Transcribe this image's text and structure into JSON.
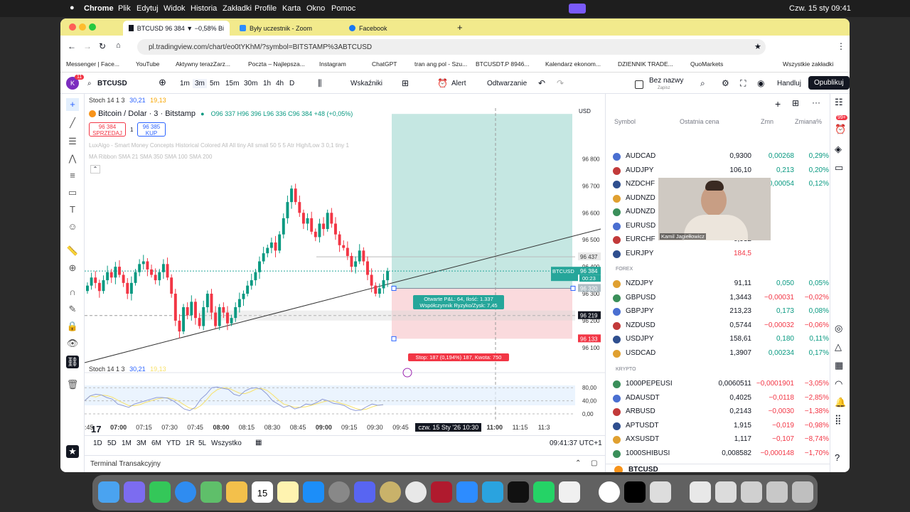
{
  "menubar": {
    "apple": "",
    "app": "Chrome",
    "items": [
      "Plik",
      "Edytuj",
      "Widok",
      "Historia",
      "Zakładki",
      "Profile",
      "Karta",
      "Okno",
      "Pomoc"
    ],
    "clock": "Czw. 15 sty  09:41"
  },
  "tabs": [
    {
      "label": "BTCUSD 96 384 ▼ −0,58% Bi",
      "active": true
    },
    {
      "label": "Były uczestnik - Zoom",
      "active": false
    },
    {
      "label": "Facebook",
      "active": false
    }
  ],
  "address": {
    "url": "pl.tradingview.com/chart/eo0tYKhM/?symbol=BITSTAMP%3ABTCUSD"
  },
  "bookmarks": [
    "Messenger | Face...",
    "YouTube",
    "Aktywny terazZarz...",
    "Poczta – Najlepsza...",
    "Instagram",
    "ChatGPT",
    "tran ang pol - Szu...",
    "BTCUSDT.P 8946...",
    "Kalendarz ekonom...",
    "DZIENNIK TRADE...",
    "QuoMarkets",
    "Wszystkie zakładki"
  ],
  "toolbar": {
    "symbol": "BTCUSD",
    "intervals": [
      "1m",
      "3m",
      "5m",
      "15m",
      "30m",
      "1h",
      "4h",
      "D"
    ],
    "active_interval": "3m",
    "indicators": "Wskaźniki",
    "alert": "Alert",
    "replay": "Odtwarzanie",
    "layout_name": "Bez nazwy",
    "layout_sub": "Zapisz",
    "trade": "Handluj",
    "publish": "Opublikuj",
    "avatar_badge": "11"
  },
  "chart": {
    "title": "Bitcoin / Dolar · 3 · Bitstamp",
    "ohlc": "O96 337  H96 396  L96 336  C96 384  +48 (+0,05%)",
    "sell_price": "96 384",
    "sell_label": "SPRZEDAJ",
    "spread": "1",
    "buy_price": "96 385",
    "buy_label": "KUP",
    "indicator1": "LuxAlgo - Smart Money Concepts Historical Colored All All tiny All small 50 5 5 Atr High/Low 3 0,1 tiny 1",
    "indicator2": "MA Ribbon SMA 21 SMA 350 SMA 100 SMA 200",
    "stoch_top": "Stoch 14 1 3",
    "stoch_top_k": "30,21",
    "stoch_top_d": "19,13",
    "currency": "USD",
    "pnl_line1": "Otwarte P&L: 64, Ilość: 1.337",
    "pnl_line2": "Współczynnik Ryzyko/Zysk: 7,45",
    "stop_label": "Stop: 187 (0,194%) 187, Kwota: 750",
    "price_labels": {
      "top": "96 437",
      "current_sym": "BTCUSD",
      "current": "96 384",
      "countdown": "00:23",
      "entry": "96 320",
      "cross": "96 219",
      "stop": "96 133"
    },
    "y_ticks": [
      "96 800",
      "96 700",
      "96 600",
      "96 500",
      "96 400",
      "96 300",
      "96 200",
      "96 100"
    ],
    "stoch_label": "Stoch 14 1 3",
    "stoch_k": "30,21",
    "stoch_d": "19,13",
    "stoch_ticks": [
      "80,00",
      "40,00",
      "0,00"
    ]
  },
  "chart_data": {
    "type": "candlestick",
    "title": "Bitcoin / Dolar · 3 · Bitstamp",
    "x_ticks": [
      ":45",
      "07:00",
      "07:15",
      "07:30",
      "07:45",
      "08:00",
      "08:15",
      "08:30",
      "08:45",
      "09:00",
      "09:15",
      "09:30",
      "09:45",
      "10:00",
      "czw. 15 Sty '26   10:30",
      "11:00",
      "11:15",
      "11:3"
    ],
    "ylim": [
      96060,
      96920
    ],
    "y_ticks": [
      96800,
      96700,
      96600,
      96500,
      96400,
      96300,
      96200,
      96100
    ],
    "close": [
      96330,
      96360,
      96340,
      96310,
      96350,
      96380,
      96360,
      96400,
      96370,
      96340,
      96300,
      96340,
      96380,
      96410,
      96420,
      96390,
      96370,
      96350,
      96380,
      96410,
      96360,
      96300,
      96200,
      96160,
      96250,
      96220,
      96270,
      96210,
      96180,
      96250,
      96300,
      96230,
      96180,
      96250,
      96230,
      96190,
      96210,
      96250,
      96280,
      96300,
      96330,
      96350,
      96380,
      96420,
      96450,
      96470,
      96490,
      96460,
      96520,
      96580,
      96640,
      96690,
      96640,
      96600,
      96560,
      96580,
      96530,
      96510,
      96560,
      96540,
      96600,
      96560,
      96520,
      96480,
      96470,
      96440,
      96400,
      96420,
      96460,
      96420,
      96370,
      96330,
      96300,
      96320,
      96350,
      96384
    ],
    "stoch_k": [
      40,
      55,
      60,
      58,
      50,
      45,
      30,
      25,
      20,
      30,
      35,
      40,
      45,
      50,
      50,
      48,
      40,
      28,
      15,
      10,
      20,
      45,
      60,
      80,
      82,
      78,
      75,
      60,
      55,
      70,
      78,
      80,
      75,
      60,
      40,
      30,
      20,
      25,
      15,
      20,
      30,
      28,
      35,
      45,
      40,
      32,
      30,
      25,
      15,
      10,
      12,
      22,
      30,
      26,
      28
    ],
    "position": {
      "entry": 96320,
      "target": 96930,
      "stop": 96133,
      "qty": 1.337,
      "pnl": 64,
      "risk_reward": 7.45
    }
  },
  "timeaxis": {
    "highlight": "czw. 15 Sty '26   10:30"
  },
  "bottombar": {
    "ranges": [
      "1D",
      "5D",
      "1M",
      "3M",
      "6M",
      "YTD",
      "1R",
      "5L",
      "Wszystko"
    ],
    "clock": "09:41:37 UTC+1",
    "terminal": "Terminal Transakcyjny"
  },
  "watchlist": {
    "headers": [
      "Symbol",
      "Ostatnia cena",
      "Zmn",
      "Zmiana%"
    ],
    "group1": [
      {
        "sym": "AUDCAD",
        "price": "0,9300",
        "chg": "0,00268",
        "pct": "0,29%",
        "dir": "pos"
      },
      {
        "sym": "AUDJPY",
        "price": "106,10",
        "chg": "0,213",
        "pct": "0,20%",
        "dir": "pos"
      },
      {
        "sym": "NZDCHF",
        "price": "0,460",
        "chg": "0,00054",
        "pct": "0,12%",
        "dir": "pos"
      },
      {
        "sym": "AUDNZD",
        "price": "1,164",
        "chg": "",
        "pct": "",
        "dir": "pos"
      },
      {
        "sym": "AUDNZD",
        "price": "1,164",
        "chg": "",
        "pct": "",
        "dir": "pos"
      },
      {
        "sym": "EURUSD",
        "price": "1,163",
        "chg": "",
        "pct": "",
        "dir": "pos"
      },
      {
        "sym": "EURCHF",
        "price": "0,932",
        "chg": "",
        "pct": "",
        "dir": "pos"
      },
      {
        "sym": "EURJPY",
        "price": "184,5",
        "chg": "",
        "pct": "",
        "dir": "neg"
      }
    ],
    "forex_label": "FOREX",
    "forex": [
      {
        "sym": "NZDJPY",
        "price": "91,11",
        "chg": "0,050",
        "pct": "0,05%",
        "dir": "pos"
      },
      {
        "sym": "GBPUSD",
        "price": "1,3443",
        "chg": "−0,00031",
        "pct": "−0,02%",
        "dir": "neg"
      },
      {
        "sym": "GBPJPY",
        "price": "213,23",
        "chg": "0,173",
        "pct": "0,08%",
        "dir": "pos"
      },
      {
        "sym": "NZDUSD",
        "price": "0,5744",
        "chg": "−0,00032",
        "pct": "−0,06%",
        "dir": "neg"
      },
      {
        "sym": "USDJPY",
        "price": "158,61",
        "chg": "0,180",
        "pct": "0,11%",
        "dir": "pos"
      },
      {
        "sym": "USDCAD",
        "price": "1,3907",
        "chg": "0,00234",
        "pct": "0,17%",
        "dir": "pos"
      }
    ],
    "crypto_label": "KRYPTO",
    "crypto": [
      {
        "sym": "1000PEPEUSI",
        "price": "0,0060511",
        "chg": "−0,0001901",
        "pct": "−3,05%",
        "dir": "neg"
      },
      {
        "sym": "ADAUSDT",
        "price": "0,4025",
        "chg": "−0,0118",
        "pct": "−2,85%",
        "dir": "neg"
      },
      {
        "sym": "ARBUSD",
        "price": "0,2143",
        "chg": "−0,0030",
        "pct": "−1,38%",
        "dir": "neg"
      },
      {
        "sym": "APTUSDT",
        "price": "1,915",
        "chg": "−0,019",
        "pct": "−0,98%",
        "dir": "neg"
      },
      {
        "sym": "AXSUSDT",
        "price": "1,117",
        "chg": "−0,107",
        "pct": "−8,74%",
        "dir": "neg"
      },
      {
        "sym": "1000SHIBUSI",
        "price": "0,008582",
        "chg": "−0,000148",
        "pct": "−1,70%",
        "dir": "neg"
      }
    ],
    "footer_symbol": "BTCUSD",
    "badge": "99+"
  },
  "webcam": {
    "name": "Kamil Jagiełłowicz"
  },
  "colors": {
    "up": "#089981",
    "down": "#f23645",
    "accent": "#2962ff"
  }
}
